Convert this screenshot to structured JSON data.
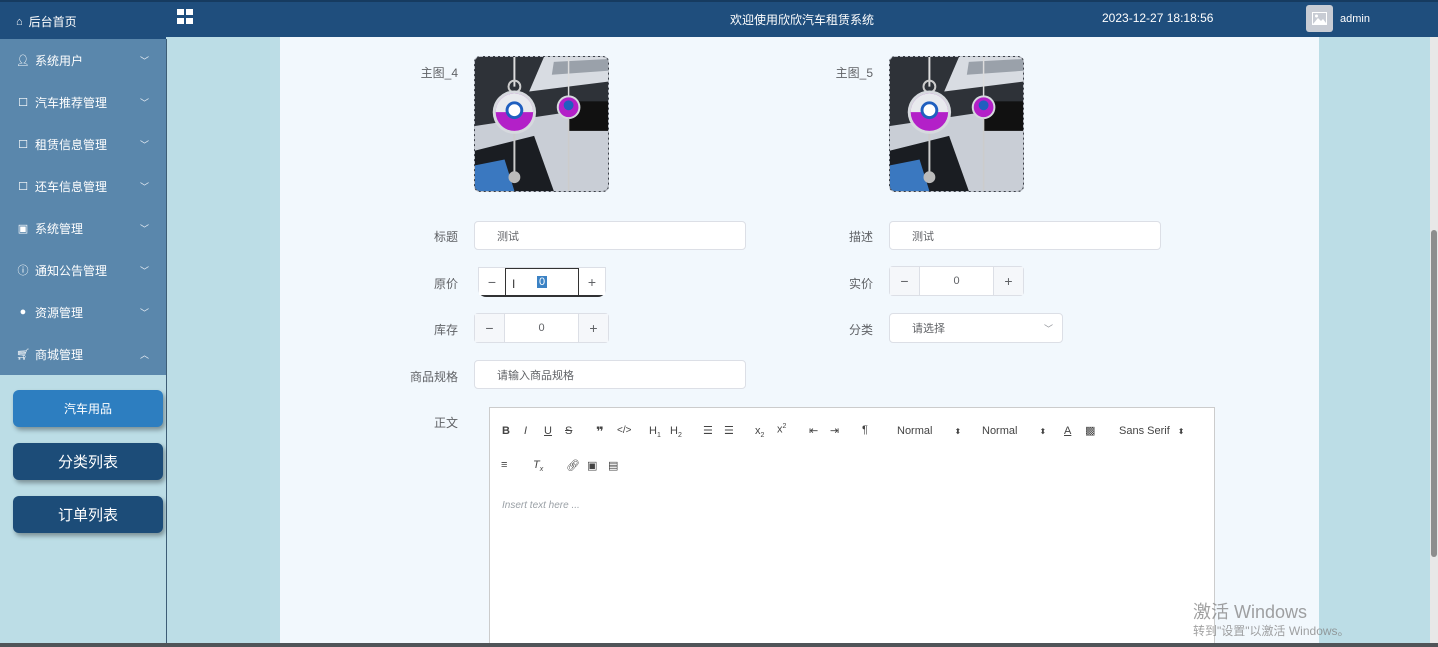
{
  "header": {
    "home_label": "后台首页",
    "system_title": "欢迎使用欣欣汽车租赁系统",
    "datetime": "2023-12-27 18:18:56",
    "username": "admin"
  },
  "sidebar": {
    "items": [
      {
        "label": "系统用户",
        "icon": "user-icon"
      },
      {
        "label": "汽车推荐管理",
        "icon": "document-icon"
      },
      {
        "label": "租赁信息管理",
        "icon": "document-icon"
      },
      {
        "label": "还车信息管理",
        "icon": "document-icon"
      },
      {
        "label": "系统管理",
        "icon": "picture-icon"
      },
      {
        "label": "通知公告管理",
        "icon": "info-icon"
      },
      {
        "label": "资源管理",
        "icon": "bulb-icon"
      },
      {
        "label": "商城管理",
        "icon": "cart-icon"
      }
    ],
    "sub_items": [
      {
        "label": "汽车用品",
        "active": true
      },
      {
        "label": "分类列表",
        "active": false
      },
      {
        "label": "订单列表",
        "active": false
      }
    ]
  },
  "form": {
    "image4_label": "主图_4",
    "image5_label": "主图_5",
    "title_label": "标题",
    "title_value": "测试",
    "desc_label": "描述",
    "desc_value": "测试",
    "orig_price_label": "原价",
    "orig_price_value": "0",
    "sale_price_label": "实价",
    "sale_price_value": "0",
    "stock_label": "库存",
    "stock_value": "0",
    "category_label": "分类",
    "category_placeholder": "请选择",
    "spec_label": "商品规格",
    "spec_placeholder": "请输入商品规格",
    "body_label": "正文",
    "minus": "−",
    "plus": "+"
  },
  "editor": {
    "size_select": "Normal",
    "header_select": "Normal",
    "font_select": "Sans Serif",
    "placeholder": "Insert text here ..."
  },
  "watermark": {
    "line1": "激活 Windows",
    "line2": "转到\"设置\"以激活 Windows。"
  }
}
